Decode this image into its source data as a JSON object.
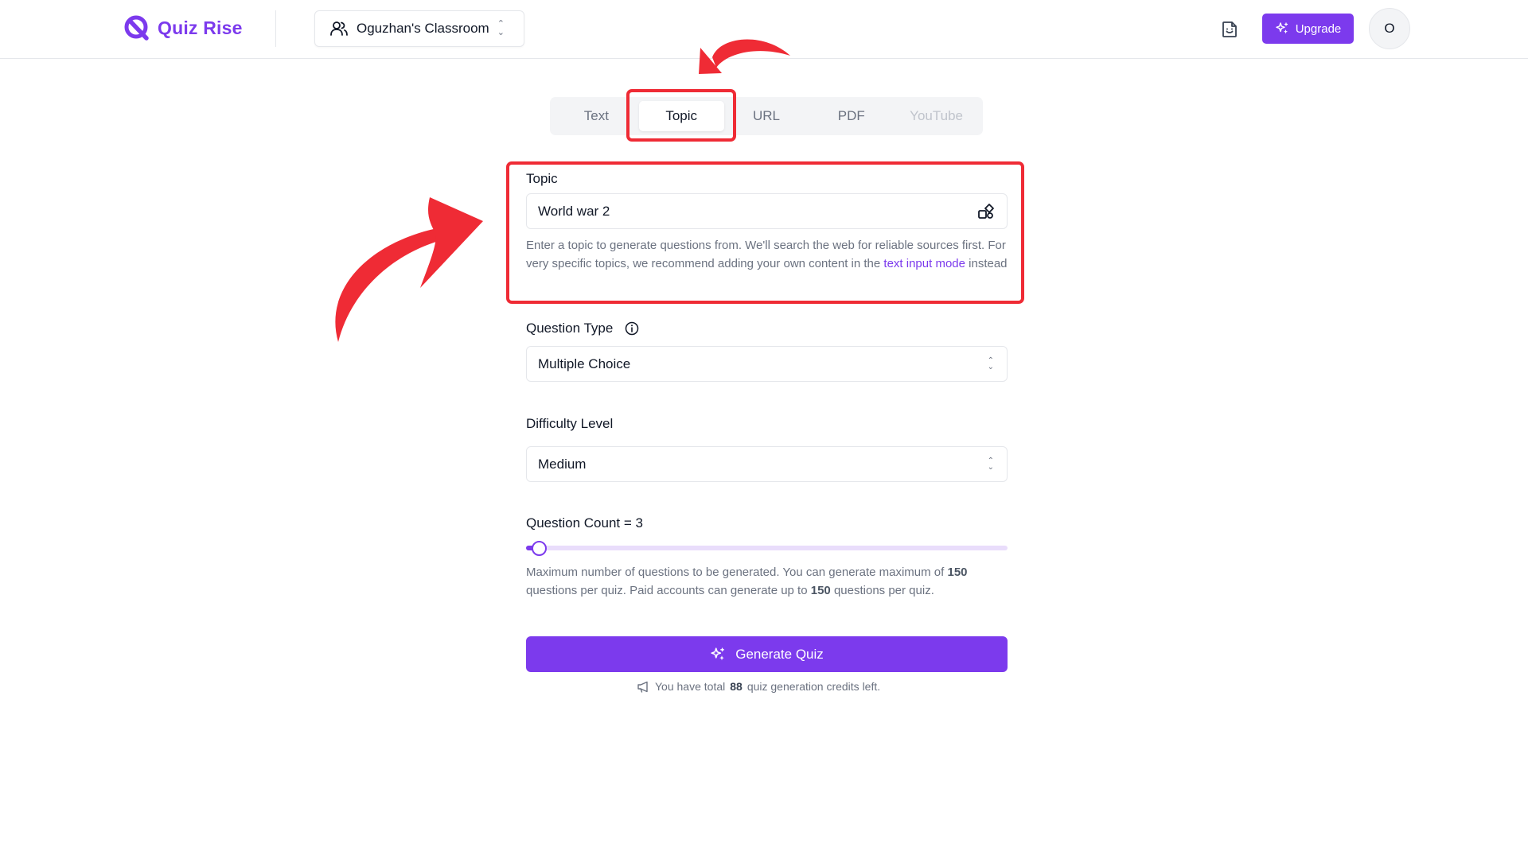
{
  "header": {
    "brand": "Quiz Rise",
    "classroom": "Oguzhan's Classroom",
    "upgrade_label": "Upgrade",
    "avatar_initial": "O"
  },
  "tabs": [
    {
      "label": "Text",
      "state": "inactive"
    },
    {
      "label": "Topic",
      "state": "active"
    },
    {
      "label": "URL",
      "state": "inactive"
    },
    {
      "label": "PDF",
      "state": "inactive"
    },
    {
      "label": "YouTube",
      "state": "disabled"
    }
  ],
  "topic": {
    "label": "Topic",
    "value": "World war 2",
    "help_part1": "Enter a topic to generate questions from. We'll search the web for reliable sources first. For very specific topics, we recommend adding your own content in the",
    "help_link": "text input mode",
    "help_part2": "instead"
  },
  "question_type": {
    "label": "Question Type",
    "value": "Multiple Choice"
  },
  "difficulty": {
    "label": "Difficulty Level",
    "value": "Medium"
  },
  "question_count": {
    "label": "Question Count = 3",
    "value": 3,
    "max": 150,
    "help_part1": "Maximum number of questions to be generated. You can generate maximum of",
    "max_free": "150",
    "help_part2": "questions per quiz. Paid accounts can generate up to",
    "max_paid": "150",
    "help_part3": "questions per quiz."
  },
  "generate_label": "Generate Quiz",
  "credits": {
    "prefix": "You have total",
    "count": "88",
    "suffix": "quiz generation credits left."
  },
  "icons": {
    "logo": "quiz-rise-logo-icon",
    "classroom": "users-icon",
    "header_action": "file-smile-icon",
    "upgrade": "sparkles-icon",
    "topic_input": "shapes-icon",
    "info": "info-icon",
    "generate": "sparkles-icon",
    "credits": "megaphone-icon"
  },
  "colors": {
    "brand": "#7c3aed",
    "highlight": "#ef2b35"
  }
}
